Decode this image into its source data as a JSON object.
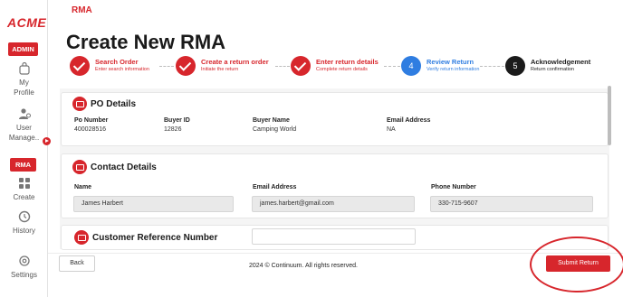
{
  "sidebar": {
    "logo": "ACME",
    "admin_badge": "ADMIN",
    "items": [
      {
        "label_line1": "My",
        "label_line2": "Profile",
        "icon": "profile-icon"
      },
      {
        "label_line1": "User",
        "label_line2": "Manage..",
        "icon": "user-manage-icon"
      },
      {
        "label_line1": "Create",
        "label_line2": "",
        "icon": "grid-icon"
      },
      {
        "label_line1": "History",
        "label_line2": "",
        "icon": "history-icon"
      },
      {
        "label_line1": "Settings",
        "label_line2": "",
        "icon": "gear-icon"
      }
    ],
    "rma_badge": "RMA"
  },
  "breadcrumb": "RMA",
  "page_title": "Create New RMA",
  "steps": [
    {
      "title": "Search Order",
      "subtitle": "Enter search information",
      "state": "done"
    },
    {
      "title": "Create a return order",
      "subtitle": "Initiate the return",
      "state": "done"
    },
    {
      "title": "Enter return details",
      "subtitle": "Complete return details",
      "state": "done"
    },
    {
      "title": "Review Return",
      "subtitle": "Verify return information",
      "state": "active",
      "number": "4"
    },
    {
      "title": "Acknowledgement",
      "subtitle": "Return confirmation",
      "state": "pending",
      "number": "5"
    }
  ],
  "po_details": {
    "title": "PO Details",
    "fields": [
      {
        "label": "Po Number",
        "value": "400028516"
      },
      {
        "label": "Buyer ID",
        "value": "12826"
      },
      {
        "label": "Buyer Name",
        "value": "Camping World"
      },
      {
        "label": "Email Address",
        "value": "NA"
      }
    ]
  },
  "contact_details": {
    "title": "Contact Details",
    "name_label": "Name",
    "name_value": "James Harbert",
    "email_label": "Email Address",
    "email_value": "james.harbert@gmail.com",
    "phone_label": "Phone Number",
    "phone_value": "330-715-9607"
  },
  "customer_ref": {
    "title": "Customer Reference Number",
    "value": ""
  },
  "footer": {
    "back_label": "Back",
    "copyright": "2024 © Continuum. All rights reserved.",
    "submit_label": "Submit Return"
  },
  "colors": {
    "accent": "#d7262c",
    "active_step": "#2f7de1"
  }
}
